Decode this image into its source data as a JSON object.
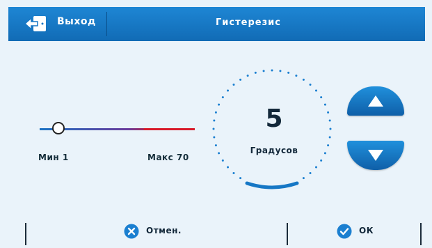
{
  "header": {
    "exit_label": "Выход",
    "title": "Гистерезис"
  },
  "slider": {
    "min_label": "Мин 1",
    "max_label": "Макс 70",
    "min": 1,
    "max": 70,
    "value": 5
  },
  "dial": {
    "value": "5",
    "unit": "Градусов"
  },
  "buttons": {
    "cancel_label": "Отмен.",
    "ok_label": "ОК"
  },
  "icons": {
    "exit": "exit-door-icon",
    "up": "arrow-up-icon",
    "down": "arrow-down-icon",
    "cancel": "close-circle-icon",
    "ok": "check-circle-icon"
  },
  "colors": {
    "header_blue": "#1677c5",
    "accent_blue": "#1b7fd0",
    "slider_red": "#d81a2a",
    "text_dark": "#13283a",
    "background": "#eaf3fa"
  }
}
